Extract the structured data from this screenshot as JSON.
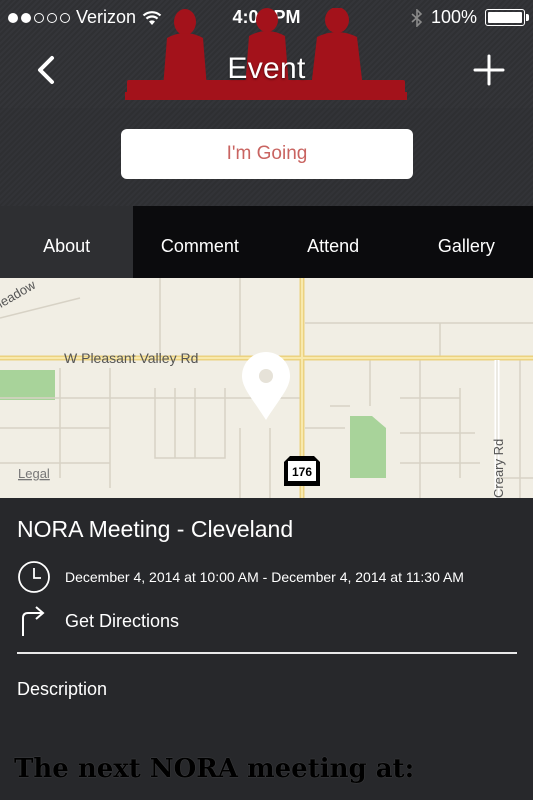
{
  "status_bar": {
    "carrier": "Verizon",
    "time": "4:08 PM",
    "battery": "100%",
    "battery_level": 1.0,
    "signal_bars_filled": 2,
    "signal_bars_total": 5
  },
  "header": {
    "title": "Event",
    "back_icon": "chevron-left-icon",
    "add_icon": "plus-icon",
    "logo_color": "#a3121b"
  },
  "rsvp": {
    "label": "I'm Going",
    "label_color": "#c96461"
  },
  "tabs": [
    {
      "label": "About",
      "active": true
    },
    {
      "label": "Comment",
      "active": false
    },
    {
      "label": "Attend",
      "active": false
    },
    {
      "label": "Gallery",
      "active": false
    }
  ],
  "map": {
    "streets": [
      "W Pleasant Valley Rd",
      "Creary Rd",
      "Meadow"
    ],
    "route_shield": "176",
    "legal": "Legal"
  },
  "event": {
    "title": "NORA Meeting - Cleveland",
    "time_range": "December 4, 2014 at 10:00 AM - December 4, 2014 at 11:30 AM",
    "directions_label": "Get Directions",
    "description_label": "Description",
    "description_text": "The next NORA meeting at:"
  }
}
